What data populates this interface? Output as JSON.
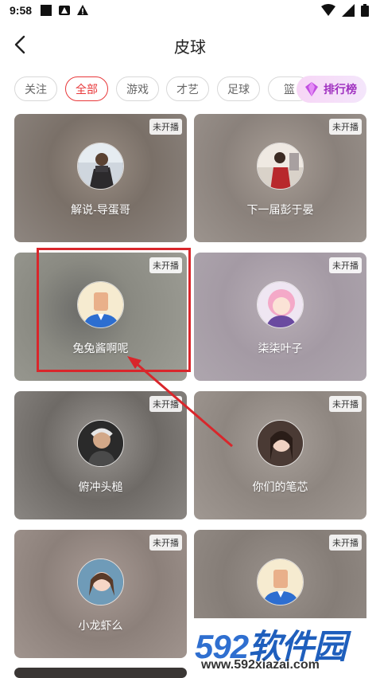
{
  "status": {
    "time": "9:58"
  },
  "header": {
    "title": "皮球"
  },
  "tabs": [
    {
      "label": "关注"
    },
    {
      "label": "全部"
    },
    {
      "label": "游戏"
    },
    {
      "label": "才艺"
    },
    {
      "label": "足球"
    },
    {
      "label": "篮"
    }
  ],
  "rank": {
    "label": "排行榜"
  },
  "cards": [
    {
      "name": "解说-导蛋哥",
      "badge": "未开播"
    },
    {
      "name": "下一届彭于晏",
      "badge": "未开播"
    },
    {
      "name": "兔兔酱啊呢",
      "badge": "未开播"
    },
    {
      "name": "柒柒叶子",
      "badge": "未开播"
    },
    {
      "name": "俯冲头槌",
      "badge": "未开播"
    },
    {
      "name": "你们的笔芯",
      "badge": "未开播"
    },
    {
      "name": "小龙虾么",
      "badge": "未开播"
    },
    {
      "name": "",
      "badge": "未开播"
    }
  ],
  "watermark": {
    "logo_num": "592",
    "logo_text": "软件园",
    "url": "www.592xiazai.com"
  }
}
